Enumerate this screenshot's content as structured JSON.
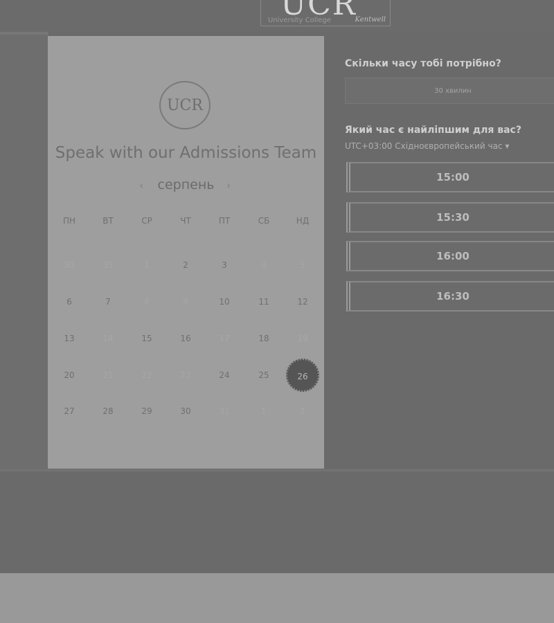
{
  "header": {
    "logo_text": "UCR",
    "logo_subtitle": "University College",
    "logo_script": "Kentwell"
  },
  "card": {
    "logo_text": "UCR",
    "title": "Speak with our Admissions Team",
    "month": "серпень",
    "prev_icon": "chevron-left-icon",
    "next_icon": "chevron-right-icon",
    "weekdays": [
      "ПН",
      "ВТ",
      "СР",
      "ЧТ",
      "ПТ",
      "СБ",
      "НД"
    ],
    "weeks": [
      [
        {
          "d": "30",
          "muted": true
        },
        {
          "d": "31",
          "muted": true
        },
        {
          "d": "1",
          "muted": true
        },
        {
          "d": "2",
          "muted": false
        },
        {
          "d": "3",
          "muted": false
        },
        {
          "d": "4",
          "muted": true
        },
        {
          "d": "5",
          "muted": true
        }
      ],
      [
        {
          "d": "6",
          "muted": false
        },
        {
          "d": "7",
          "muted": false
        },
        {
          "d": "8",
          "muted": true
        },
        {
          "d": "9",
          "muted": true
        },
        {
          "d": "10",
          "muted": false
        },
        {
          "d": "11",
          "muted": false
        },
        {
          "d": "12",
          "muted": false
        }
      ],
      [
        {
          "d": "13",
          "muted": false
        },
        {
          "d": "14",
          "muted": true
        },
        {
          "d": "15",
          "muted": false
        },
        {
          "d": "16",
          "muted": false
        },
        {
          "d": "17",
          "muted": true
        },
        {
          "d": "18",
          "muted": false
        },
        {
          "d": "19",
          "muted": true
        }
      ],
      [
        {
          "d": "20",
          "muted": false
        },
        {
          "d": "21",
          "muted": true
        },
        {
          "d": "22",
          "muted": true
        },
        {
          "d": "23",
          "muted": true
        },
        {
          "d": "24",
          "muted": false
        },
        {
          "d": "25",
          "muted": false
        },
        {
          "d": "26",
          "muted": false,
          "selected": true
        }
      ],
      [
        {
          "d": "27",
          "muted": false
        },
        {
          "d": "28",
          "muted": false
        },
        {
          "d": "29",
          "muted": false
        },
        {
          "d": "30",
          "muted": false
        },
        {
          "d": "31",
          "muted": true
        },
        {
          "d": "1",
          "muted": true
        },
        {
          "d": "2",
          "muted": true
        }
      ]
    ]
  },
  "booking": {
    "duration_question": "Скільки часу тобі потрібно?",
    "duration_value": "30 хвилин",
    "time_question": "Який час є найліпшим для вас?",
    "timezone": "UTC+03:00 Східноєвропейський час ▾",
    "slots": [
      "15:00",
      "15:30",
      "16:00",
      "16:30"
    ]
  }
}
